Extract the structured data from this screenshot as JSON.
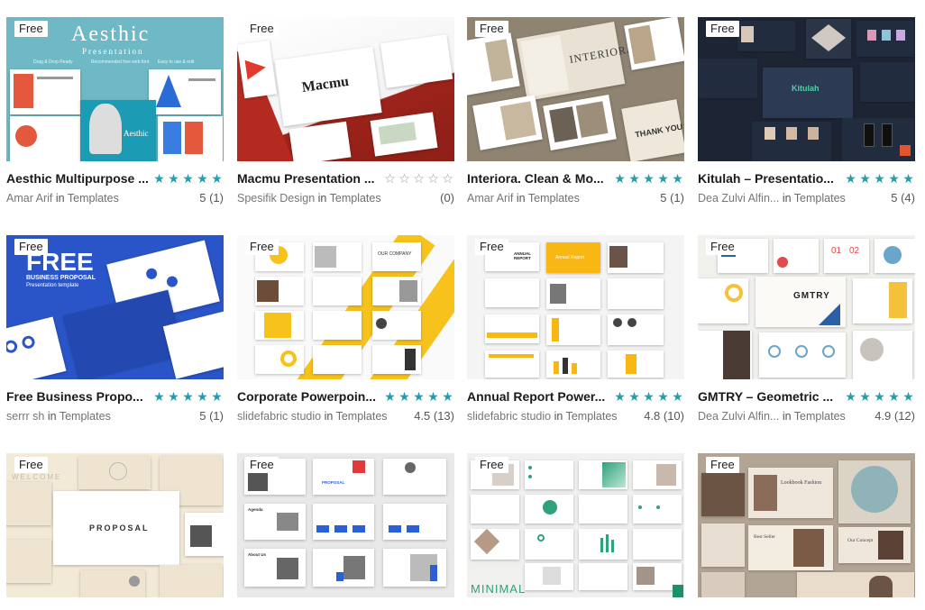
{
  "badge_text": "Free",
  "in_text": "in",
  "colors": {
    "star": "#1e9fb0",
    "star_empty": "#9a9a9a"
  },
  "cards": [
    {
      "title": "Aesthic Multipurpose ...",
      "author": "Amar Arif",
      "category": "Templates",
      "rating": "5 (1)",
      "stars": 5,
      "thumb_text": {
        "heading": "Aesthic",
        "sub": "Presentation",
        "f1": "Drag & Drop Ready",
        "f2": "Recommended free web font",
        "f3": "Easy to use & edit",
        "slide": "Aesthic"
      }
    },
    {
      "title": "Macmu Presentation ...",
      "author": "Spesifik Design",
      "category": "Templates",
      "rating": "(0)",
      "stars": 0,
      "thumb_text": {
        "heading": "Macmu"
      }
    },
    {
      "title": "Interiora. Clean & Mo...",
      "author": "Amar Arif",
      "category": "Templates",
      "rating": "5 (1)",
      "stars": 5,
      "thumb_text": {
        "heading": "INTERIORA",
        "sub": "THANK YOU"
      }
    },
    {
      "title": "Kitulah – Presentatio...",
      "author": "Dea Zulvi Alfin...",
      "category": "Templates",
      "rating": "5 (4)",
      "stars": 5,
      "thumb_text": {
        "heading": "Kitulah"
      }
    },
    {
      "title": "Free Business Propo...",
      "author": "serrr sh",
      "category": "Templates",
      "rating": "5 (1)",
      "stars": 5,
      "thumb_text": {
        "heading": "FREE",
        "sub": "BUSINESS PROPOSAL",
        "f1": "Presentation template"
      }
    },
    {
      "title": "Corporate Powerpoin...",
      "author": "slidefabric studio",
      "category": "Templates",
      "rating": "4.5 (13)",
      "stars": 5,
      "thumb_text": {
        "heading": "OUR COMPANY"
      }
    },
    {
      "title": "Annual Report Power...",
      "author": "slidefabric studio",
      "category": "Templates",
      "rating": "4.8 (10)",
      "stars": 5,
      "thumb_text": {
        "heading": "ANNUAL REPORT",
        "sub": "Annual Report"
      }
    },
    {
      "title": "GMTRY – Geometric ...",
      "author": "Dea Zulvi Alfin...",
      "category": "Templates",
      "rating": "4.9 (12)",
      "stars": 5,
      "thumb_text": {
        "heading": "GMTRY",
        "n1": "01",
        "n2": "02"
      }
    },
    {
      "title": "",
      "author": "",
      "category": "",
      "rating": "",
      "stars": 0,
      "thumb_text": {
        "heading": "PROPOSAL",
        "sub": "WELCOME"
      }
    },
    {
      "title": "",
      "author": "",
      "category": "",
      "rating": "",
      "stars": 0,
      "thumb_text": {
        "heading": "PROPOSAL",
        "a1": "Agenda",
        "a2": "About Us"
      }
    },
    {
      "title": "",
      "author": "",
      "category": "",
      "rating": "",
      "stars": 0,
      "thumb_text": {
        "heading": "MINIMAL"
      }
    },
    {
      "title": "",
      "author": "",
      "category": "",
      "rating": "",
      "stars": 0,
      "thumb_text": {
        "heading": "Lookbook Fashion",
        "sub": "Best Seller",
        "f1": "Our Concept"
      }
    }
  ]
}
